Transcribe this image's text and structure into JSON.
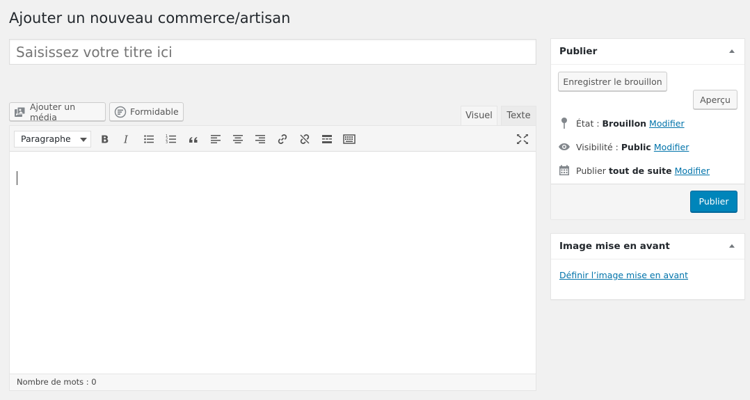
{
  "page": {
    "title": "Ajouter un nouveau commerce/artisan"
  },
  "title_input": {
    "placeholder": "Saisissez votre titre ici",
    "value": ""
  },
  "media_buttons": {
    "add_media": "Ajouter un média",
    "formidable": "Formidable"
  },
  "editor_tabs": {
    "visual": "Visuel",
    "text": "Texte"
  },
  "toolbar": {
    "format": "Paragraphe",
    "icons": [
      "bold-icon",
      "italic-icon",
      "bullet-list-icon",
      "numbered-list-icon",
      "blockquote-icon",
      "align-left-icon",
      "align-center-icon",
      "align-right-icon",
      "link-icon",
      "unlink-icon",
      "read-more-icon",
      "toolbar-toggle-icon",
      "fullscreen-icon"
    ]
  },
  "status_bar": {
    "word_count": "Nombre de mots : 0"
  },
  "publish_box": {
    "title": "Publier",
    "save_draft": "Enregistrer le brouillon",
    "preview": "Aperçu",
    "state_label": "État :",
    "state_value": "Brouillon",
    "visibility_label": "Visibilité :",
    "visibility_value": "Public",
    "schedule_label": "Publier",
    "schedule_value": "tout de suite",
    "edit_link": "Modifier",
    "publish": "Publier"
  },
  "featured_image_box": {
    "title": "Image mise en avant",
    "set_link": "Définir l’image mise en avant"
  },
  "colors": {
    "accent": "#0085ba",
    "link": "#0073aa",
    "background": "#f1f1f1"
  }
}
